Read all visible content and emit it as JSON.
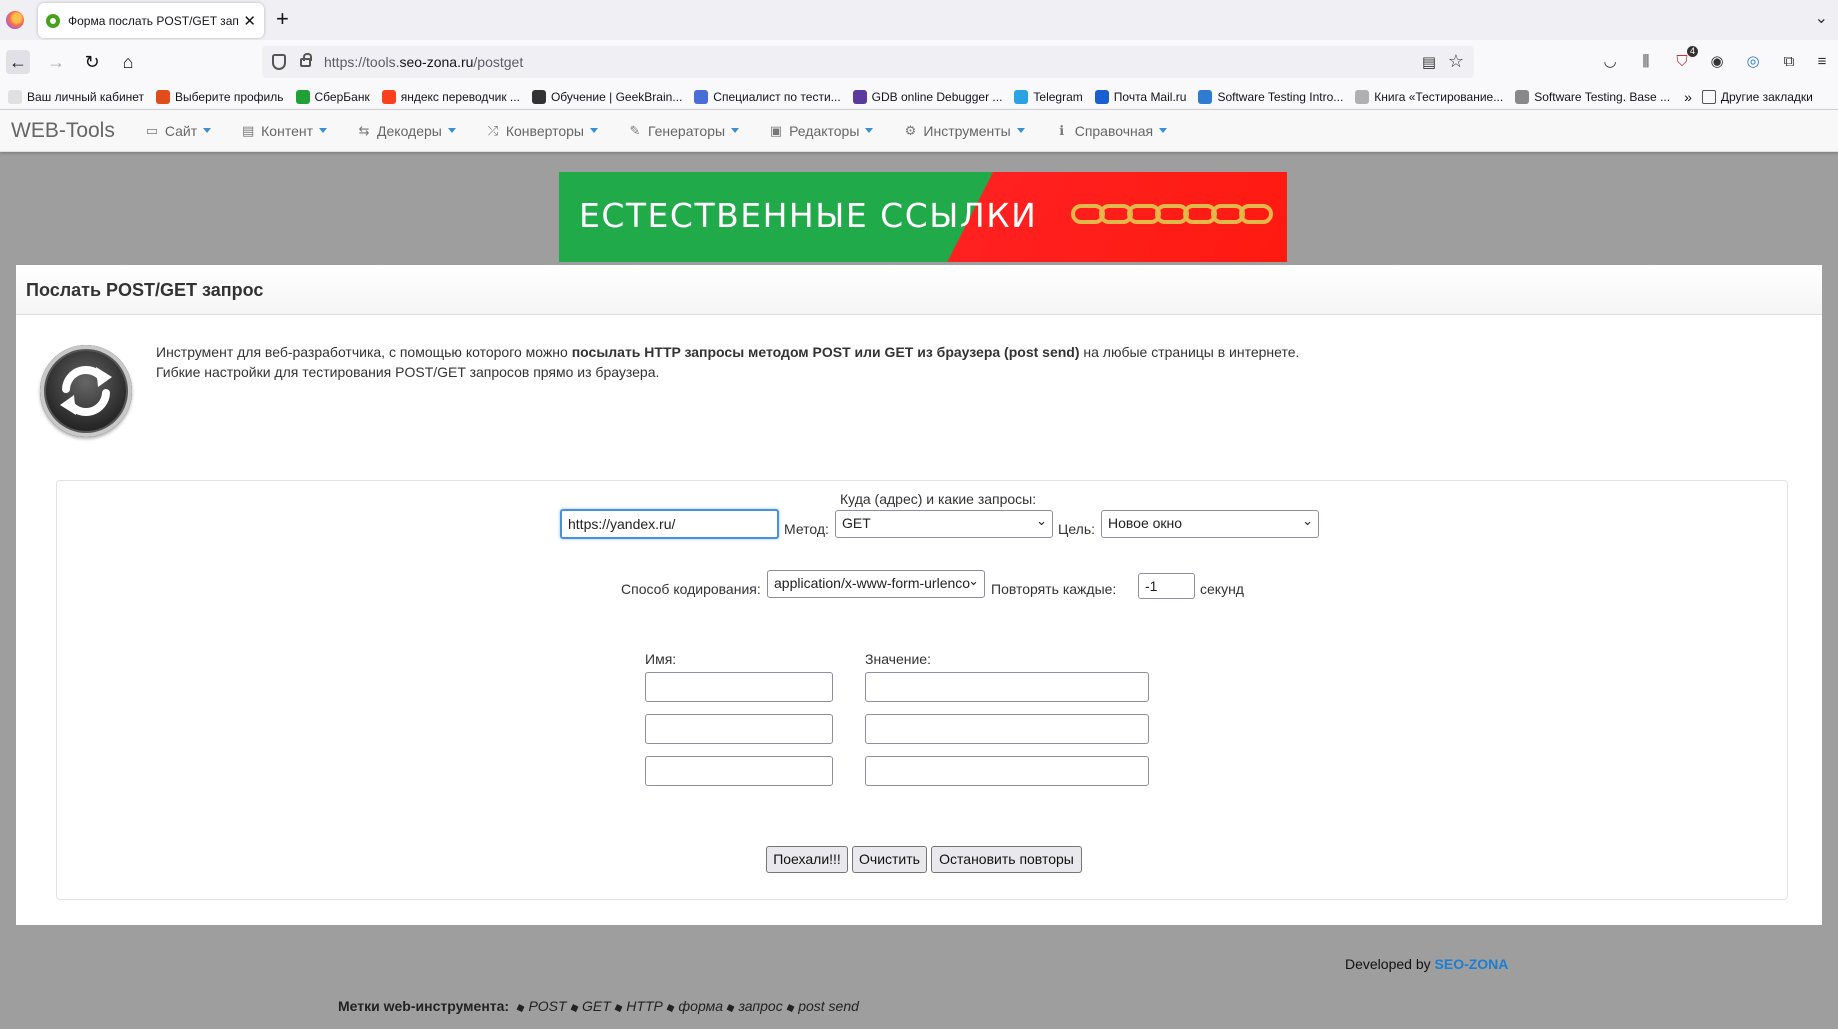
{
  "browser": {
    "tab_title": "Форма послать POST/GET запр",
    "url_prefix": "https://tools.",
    "url_domain": "seo-zona.ru",
    "url_path": "/postget",
    "bookmarks": [
      {
        "label": "Ваш личный кабинет",
        "color": "#e0e0e0"
      },
      {
        "label": "Выберите профиль",
        "color": "#e24c1c"
      },
      {
        "label": "СберБанк",
        "color": "#21a038"
      },
      {
        "label": "яндекс переводчик ...",
        "color": "#fc3f1d"
      },
      {
        "label": "Обучение | GeekBrain...",
        "color": "#333333"
      },
      {
        "label": "Специалист по тести...",
        "color": "#4b6ed6"
      },
      {
        "label": "GDB online Debugger ...",
        "color": "#5b3a9e"
      },
      {
        "label": "Telegram",
        "color": "#2aa3e0"
      },
      {
        "label": "Почта Mail.ru",
        "color": "#1a5fd0"
      },
      {
        "label": "Software Testing Intro...",
        "color": "#2f7bd0"
      },
      {
        "label": "Книга «Тестирование...",
        "color": "#b0b0b0"
      },
      {
        "label": "Software Testing. Base ...",
        "color": "#888888"
      }
    ],
    "other_bookmarks": "Другие закладки",
    "extension_badge": "4"
  },
  "site": {
    "brand": "WEB-Tools",
    "nav": [
      {
        "label": "Сайт",
        "icon": "monitor-icon"
      },
      {
        "label": "Контент",
        "icon": "file-icon"
      },
      {
        "label": "Декодеры",
        "icon": "retweet-icon"
      },
      {
        "label": "Конверторы",
        "icon": "shuffle-icon"
      },
      {
        "label": "Генераторы",
        "icon": "magic-icon"
      },
      {
        "label": "Редакторы",
        "icon": "save-icon"
      },
      {
        "label": "Инструменты",
        "icon": "cogs-icon"
      },
      {
        "label": "Справочная",
        "icon": "info-icon"
      }
    ],
    "banner_text": "ЕСТЕСТВЕННЫЕ ССЫЛКИ"
  },
  "page": {
    "title": "Послать POST/GET запрос",
    "intro_line1_pre": "Инструмент для веб-разработчика, с помощью которого можно ",
    "intro_line1_bold": "посылать HTTP запросы методом POST или GET из браузера (post send)",
    "intro_line1_post": " на любые страницы в интернете.",
    "intro_line2": "Гибкие настройки для тестирования POST/GET запросов прямо из браузера."
  },
  "form": {
    "address_label": "Куда (адрес) и какие запросы:",
    "url_value": "https://yandex.ru/",
    "method_label": "Метод:",
    "method_value": "GET",
    "target_label": "Цель:",
    "target_value": "Новое окно",
    "encoding_label": "Способ кодирования:",
    "encoding_value": "application/x-www-form-urlenco",
    "repeat_label": "Повторять каждые:",
    "repeat_value": "-1",
    "seconds_label": "секунд",
    "name_label": "Имя:",
    "value_label": "Значение:",
    "submit_label": "Поехали!!!",
    "clear_label": "Очистить",
    "stop_label": "Остановить повторы"
  },
  "footer": {
    "developed_by": "Developed by",
    "developer": "SEO-ZONA",
    "tags_label": "Метки web-инструмента:",
    "tags": [
      "POST",
      "GET",
      "HTTP",
      "форма",
      "запрос",
      "post send"
    ]
  }
}
